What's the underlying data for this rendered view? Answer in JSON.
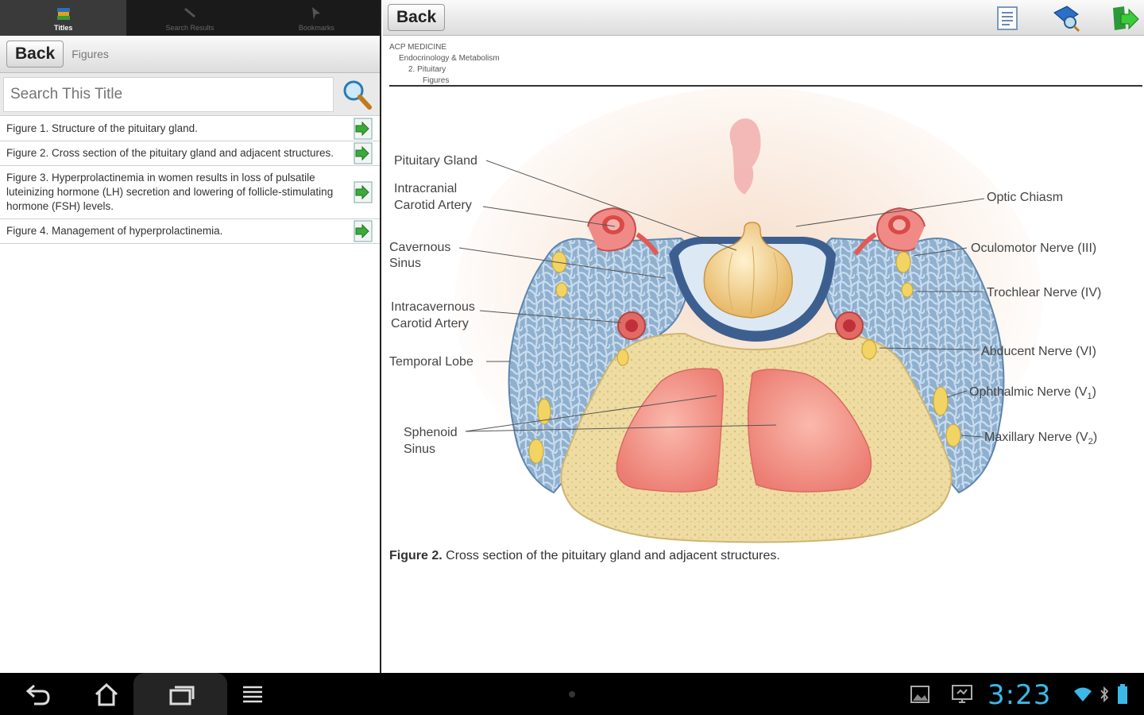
{
  "left": {
    "tabs": [
      {
        "label": "Titles",
        "icon": "books-icon",
        "active": true
      },
      {
        "label": "Search Results",
        "icon": "pencil-icon",
        "active": false
      },
      {
        "label": "Bookmarks",
        "icon": "bookmark-icon",
        "active": false
      }
    ],
    "back_label": "Back",
    "crumb": "Figures",
    "search_placeholder": "Search This Title",
    "figures": [
      "Figure 1. Structure of the pituitary gland.",
      "Figure 2. Cross section of the pituitary gland and adjacent structures.",
      "Figure 3. Hyperprolactinemia in women results in loss of pulsatile luteinizing hormone (LH) secretion and lowering of follicle-stimulating hormone (FSH) levels.",
      "Figure 4. Management of hyperprolactinemia."
    ]
  },
  "right": {
    "back_label": "Back",
    "toolbar_icons": [
      "contents-icon",
      "search-book-icon",
      "next-arrow-icon"
    ],
    "trail": [
      "ACP MEDICINE",
      "Endocrinology & Metabolism",
      "2. Pituitary",
      "Figures"
    ],
    "labels_left": {
      "pituitary": "Pituitary Gland",
      "intracranial_1": "Intracranial",
      "intracranial_2": "Carotid Artery",
      "cavernous_1": "Cavernous",
      "cavernous_2": "Sinus",
      "intracav_1": "Intracavernous",
      "intracav_2": "Carotid Artery",
      "temporal": "Temporal Lobe",
      "sphenoid_1": "Sphenoid",
      "sphenoid_2": "Sinus"
    },
    "labels_right": {
      "optic": "Optic Chiasm",
      "oculomotor": "Oculomotor Nerve (III)",
      "trochlear": "Trochlear Nerve (IV)",
      "abducent": "Abducent Nerve (VI)",
      "ophthalmic": "Ophthalmic Nerve (V",
      "ophthalmic_sub": "1",
      "maxillary": "Maxillary Nerve (V",
      "maxillary_sub": "2"
    },
    "caption_bold": "Figure 2.",
    "caption_text": " Cross section of the pituitary gland and adjacent structures."
  },
  "statusbar": {
    "time": "3:23",
    "nav_icons": [
      "back-nav-icon",
      "home-icon",
      "recent-apps-icon",
      "menu-icon"
    ]
  }
}
